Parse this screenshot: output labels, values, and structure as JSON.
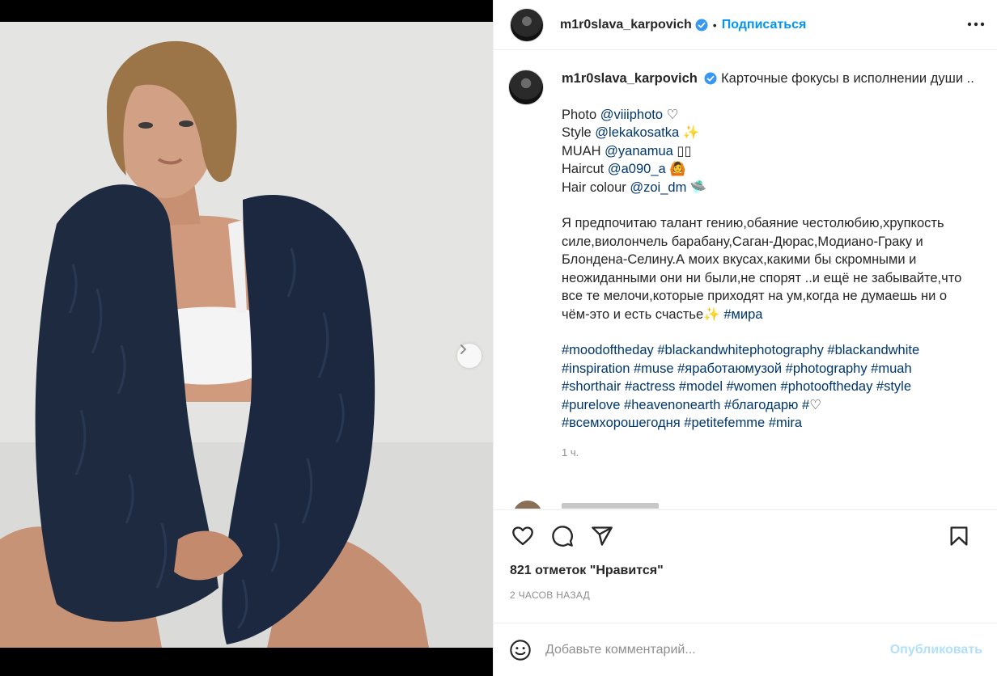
{
  "post": {
    "username": "m1r0slava_karpovich",
    "separator": "•",
    "follow_label": "Подписаться",
    "more_icon": "more-horizontal-icon"
  },
  "caption": {
    "username": "m1r0slava_karpovich",
    "line_intro": "Карточные фокусы в исполнении души ..",
    "credits": [
      {
        "label": "Photo ",
        "handle": "@viiiphoto",
        "emoji": "♡"
      },
      {
        "label": "Style ",
        "handle": "@lekakosatka",
        "emoji": "✨"
      },
      {
        "label": "MUAH ",
        "handle": "@yanamua",
        "emoji": "▯▯"
      },
      {
        "label": "Haircut ",
        "handle": "@a090_a",
        "emoji": "🙆"
      },
      {
        "label": "Hair colour ",
        "handle": "@zoi_dm",
        "emoji": "🛸"
      }
    ],
    "paragraph": "Я предпочитаю талант гению,обаяние честолюбию,хрупкость силе,виолончель барабану,Саган-Дюрас,Модиано-Граку и Блондена-Селину.А моих вкусах,какими бы скромными и неожиданными они ни были,не спорят ..и ещё не забывайте,что все те мелочи,которые приходят на ум,когда не думаешь ни о чём-это и есть счастье",
    "paragraph_emoji": "✨",
    "paragraph_tag": "#мира",
    "hashtags_line1": "#moodoftheday #blackandwhitephotography #blackandwhite",
    "hashtags_line2": "#inspiration #muse #яработаюмузой #photography #muah",
    "hashtags_line3": "#shorthair #actress #model #women #photooftheday #style",
    "hashtags_line4": "#purelove #heavenonearth #благодарю #",
    "hashtags_line4_emoji": "♡",
    "hashtags_line5": "#всемхорошегодня #petitefemme #mira",
    "time": "1 ч."
  },
  "actions": {
    "like_icon": "heart-icon",
    "comment_icon": "comment-icon",
    "share_icon": "share-icon",
    "save_icon": "bookmark-icon"
  },
  "likes_text": "821 отметок \"Нравится\"",
  "posted_text": "2 часов назад",
  "comment_box": {
    "placeholder": "Добавьте комментарий...",
    "post_label": "Опубликовать"
  },
  "media": {
    "slide_count": 2,
    "active_slide": 1,
    "colors": {
      "fur": "#1d2a40",
      "skin": "#c99478",
      "top": "#f4f4f4",
      "hair": "#9b7448"
    }
  }
}
